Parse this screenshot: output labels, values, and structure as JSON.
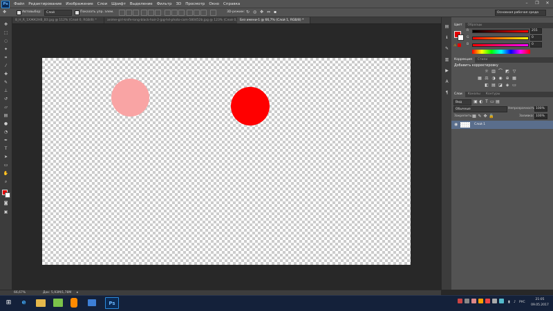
{
  "app": {
    "logo": "Ps"
  },
  "menubar": {
    "items": [
      "Файл",
      "Редактирование",
      "Изображение",
      "Слои",
      "Шрифт",
      "Выделение",
      "Фильтр",
      "3D",
      "Просмотр",
      "Окно",
      "Справка"
    ],
    "minimize": "–",
    "restore": "❐",
    "close": "✕"
  },
  "options": {
    "autoselect_label": "Автовыбор:",
    "autoselect_value": "Слой",
    "show_controls_label": "Показать упр. элем.",
    "mode_3d": "3D-режим:",
    "workspace": "Основная рабочая среда"
  },
  "tabs": [
    {
      "label": "8_H_R_1ХЖК2НВ_ВЗ.jpg @ 112% (Слой 0, RGB/8) *",
      "active": false
    },
    {
      "label": "anime-girl-knife-long-black-hair-2-jpg-hd-photo-com-580452b.jpg @ 123% (Слой 0, RGB/8*) *",
      "active": false
    },
    {
      "label": "Без имени-1 @ 66,7% (Слой 1, RGB/8) *",
      "active": true
    }
  ],
  "status": {
    "zoom": "66,67%",
    "doc": "Док: 5,93М/1,78М",
    "arrow": "▸"
  },
  "color_panel": {
    "tabs": [
      "Цвет",
      "Образцы"
    ],
    "r": "255",
    "g": "0",
    "b": "0",
    "r_label": "R",
    "g_label": "G",
    "b_label": "B"
  },
  "adjust_panel": {
    "tabs": [
      "Коррекция",
      "Стили"
    ],
    "title": "Добавить корректировку"
  },
  "layers_panel": {
    "tabs": [
      "Слои",
      "Каналы",
      "Контуры"
    ],
    "kind": "Вид",
    "mode": "Обычные",
    "opacity_label": "Непрозрачность:",
    "opacity_value": "100%",
    "lock_label": "Закрепить:",
    "fill_label": "Заливка:",
    "fill_value": "100%",
    "layer_name": "Слой 1"
  },
  "taskbar": {
    "lang": "РУС",
    "time": "21:05",
    "date": "09.05.2017",
    "ps_label": "Ps"
  },
  "colors": {
    "circle_pink": "#f9a4a4",
    "circle_red": "#ff0000",
    "fg_swatch": "#e30000"
  }
}
